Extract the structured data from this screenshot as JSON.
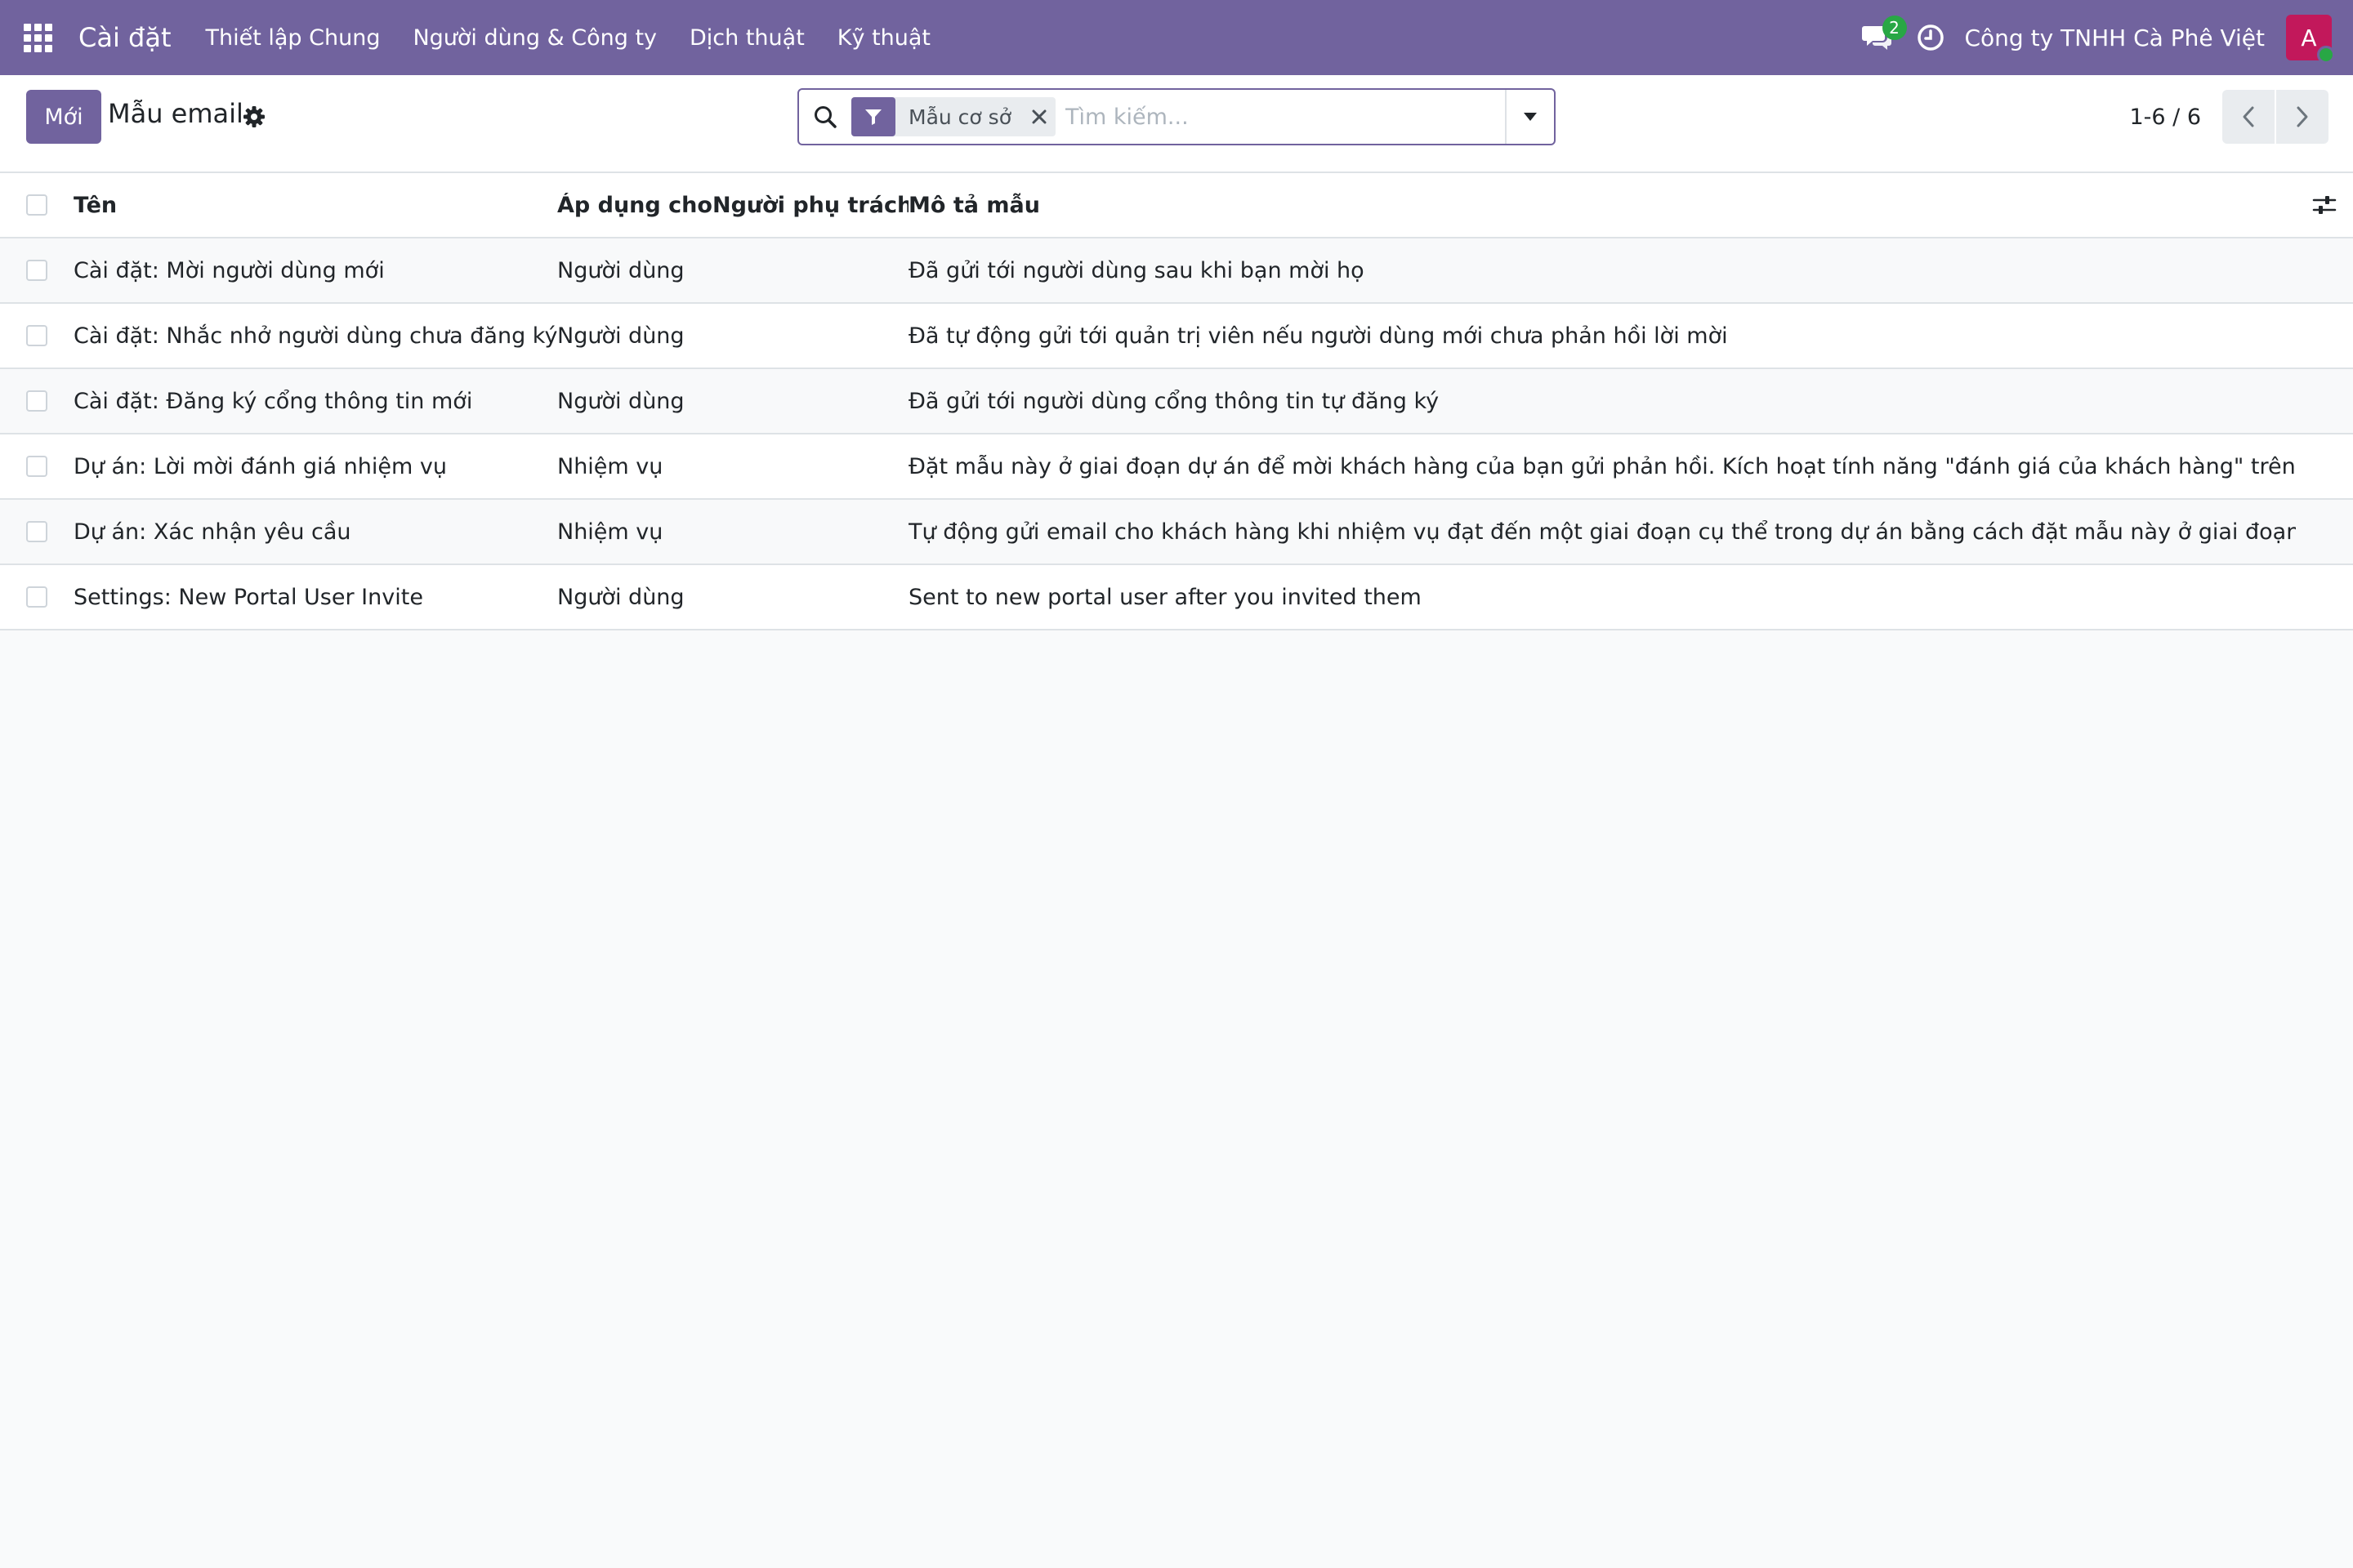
{
  "navbar": {
    "brand": "Cài đặt",
    "menu": [
      "Thiết lập Chung",
      "Người dùng & Công ty",
      "Dịch thuật",
      "Kỹ thuật"
    ],
    "chat_count": "2",
    "company": "Công ty TNHH Cà Phê Việt",
    "avatar_initial": "A",
    "accent_color": "#71639e",
    "avatar_color": "#c2185b"
  },
  "control_panel": {
    "new_label": "Mới",
    "title": "Mẫu email",
    "search": {
      "facet_label": "Mẫu cơ sở",
      "placeholder": "Tìm kiếm...",
      "value": ""
    },
    "pager": "1-6 / 6"
  },
  "table": {
    "columns": {
      "name": "Tên",
      "model": "Áp dụng cho",
      "responsible": "Người phụ trách",
      "description": "Mô tả mẫu"
    },
    "rows": [
      {
        "name": "Cài đặt: Mời người dùng mới",
        "model": "Người dùng",
        "responsible": "",
        "description": "Đã gửi tới người dùng sau khi bạn mời họ"
      },
      {
        "name": "Cài đặt: Nhắc nhở người dùng chưa đăng ký",
        "model": "Người dùng",
        "responsible": "",
        "description": "Đã tự động gửi tới quản trị viên nếu người dùng mới chưa phản hồi lời mời"
      },
      {
        "name": "Cài đặt: Đăng ký cổng thông tin mới",
        "model": "Người dùng",
        "responsible": "",
        "description": "Đã gửi tới người dùng cổng thông tin tự đăng ký"
      },
      {
        "name": "Dự án: Lời mời đánh giá nhiệm vụ",
        "model": "Nhiệm vụ",
        "responsible": "",
        "description": "Đặt mẫu này ở giai đoạn dự án để mời khách hàng của bạn gửi phản hồi. Kích hoạt tính năng \"đánh giá của khách hàng\" trên dự án"
      },
      {
        "name": "Dự án: Xác nhận yêu cầu",
        "model": "Nhiệm vụ",
        "responsible": "",
        "description": "Tự động gửi email cho khách hàng khi nhiệm vụ đạt đến một giai đoạn cụ thể trong dự án bằng cách đặt mẫu này ở giai đoạn đó"
      },
      {
        "name": "Settings: New Portal User Invite",
        "model": "Người dùng",
        "responsible": "",
        "description": "Sent to new portal user after you invited them"
      }
    ]
  }
}
